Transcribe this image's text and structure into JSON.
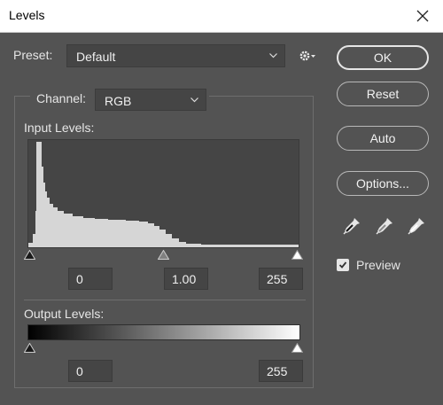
{
  "window": {
    "title": "Levels"
  },
  "preset": {
    "label": "Preset:",
    "value": "Default"
  },
  "channel": {
    "label": "Channel:",
    "value": "RGB"
  },
  "input_levels": {
    "label": "Input Levels:",
    "black": "0",
    "gamma": "1.00",
    "white": "255"
  },
  "output_levels": {
    "label": "Output Levels:",
    "black": "0",
    "white": "255"
  },
  "buttons": {
    "ok": "OK",
    "reset": "Reset",
    "auto": "Auto",
    "options": "Options..."
  },
  "preview": {
    "label": "Preview",
    "checked": true
  },
  "colors": {
    "dialog_bg": "#535353",
    "field_bg": "#454545",
    "histogram_fill": "#d6d6d6"
  },
  "icons": [
    "close-icon",
    "gear-icon",
    "chevron-down-icon",
    "black-eyedropper-icon",
    "gray-eyedropper-icon",
    "white-eyedropper-icon",
    "checkmark-icon"
  ]
}
